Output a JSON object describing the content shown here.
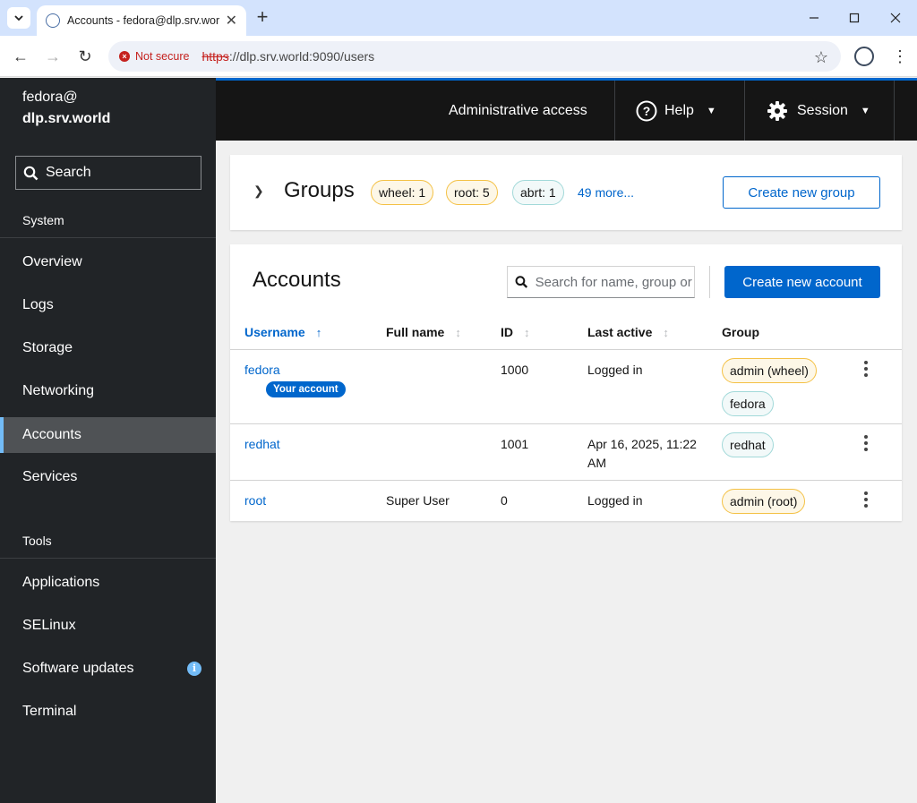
{
  "browser": {
    "tab_title": "Accounts - fedora@dlp.srv.world",
    "not_secure": "Not secure",
    "url_scheme": "https",
    "url_rest": "://dlp.srv.world:9090/users"
  },
  "sidebar": {
    "host_user": "fedora@",
    "host_name": "dlp.srv.world",
    "search_label": "Search",
    "system_heading": "System",
    "system_items": [
      "Overview",
      "Logs",
      "Storage",
      "Networking",
      "Accounts",
      "Services"
    ],
    "active_item": "Accounts",
    "tools_heading": "Tools",
    "tools_items": [
      "Applications",
      "SELinux",
      "Software updates",
      "Terminal"
    ],
    "info_glyph": "i"
  },
  "masthead": {
    "admin_access": "Administrative access",
    "help": "Help",
    "session": "Session"
  },
  "groups": {
    "title": "Groups",
    "chips": [
      {
        "label": "wheel: 1",
        "color": "gold"
      },
      {
        "label": "root: 5",
        "color": "gold"
      },
      {
        "label": "abrt: 1",
        "color": "cyan"
      }
    ],
    "more": "49 more...",
    "create_button": "Create new group"
  },
  "accounts": {
    "title": "Accounts",
    "search_placeholder": "Search for name, group or ID",
    "create_button": "Create new account",
    "columns": [
      "Username",
      "Full name",
      "ID",
      "Last active",
      "Group"
    ],
    "your_account_badge": "Your account",
    "rows": [
      {
        "username": "fedora",
        "full_name": "",
        "id": "1000",
        "last_active": "Logged in",
        "groups": [
          "admin (wheel)",
          "fedora"
        ]
      },
      {
        "username": "redhat",
        "full_name": "",
        "id": "1001",
        "last_active": "Apr 16, 2025, 11:22 AM",
        "groups": [
          "redhat"
        ]
      },
      {
        "username": "root",
        "full_name": "Super User",
        "id": "0",
        "last_active": "Logged in",
        "groups": [
          "admin (root)"
        ]
      }
    ]
  },
  "colors": {
    "accent": "#0066cc",
    "sidebar_bg": "#212427",
    "masthead_bg": "#151515",
    "active_indicator": "#73bcf7"
  }
}
